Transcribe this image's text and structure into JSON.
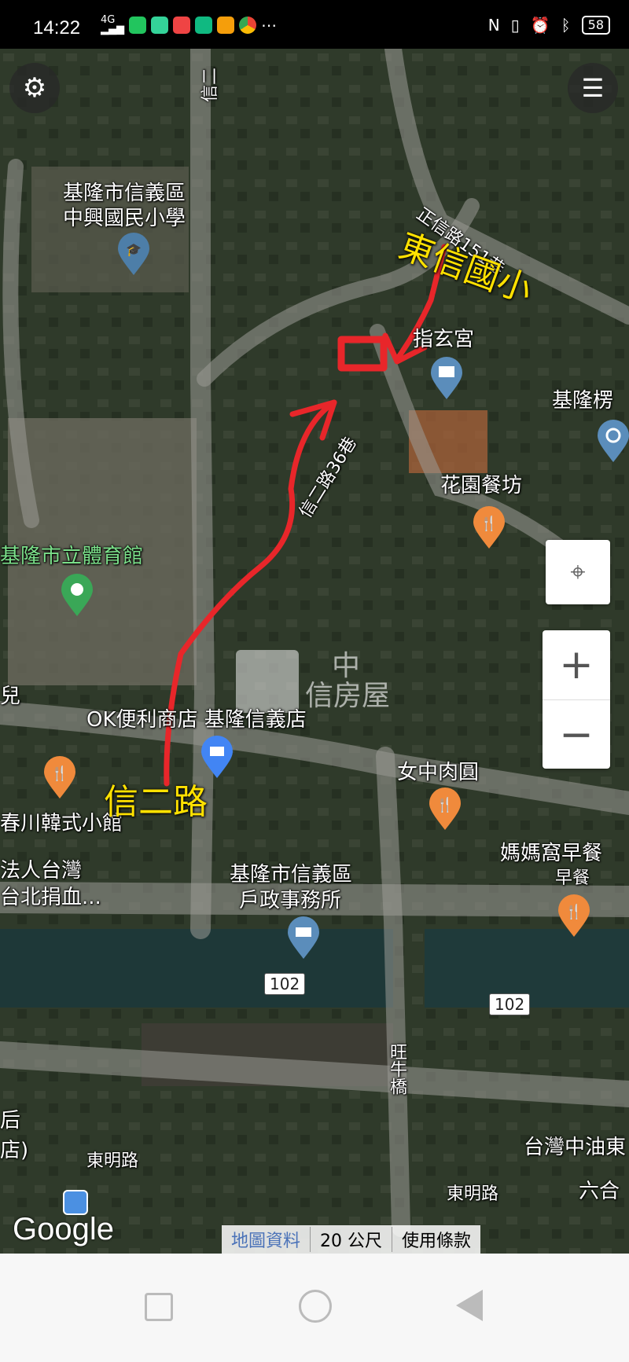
{
  "status_bar": {
    "time": "14:22",
    "network": "4G",
    "battery": "58"
  },
  "map": {
    "labels": {
      "school_1": "基隆市信義區",
      "school_2": "中興國民小學",
      "zhixuan": "指玄宮",
      "stadium": "基隆市立體育館",
      "restaurant_garden": "花園餐坊",
      "ok_store": "OK便利商店 基隆信義店",
      "meatball": "女中肉圓",
      "korean": "春川韓式小館",
      "blood_1": "法人台灣",
      "blood_2": "台北捐血...",
      "household_1": "基隆市信義區",
      "household_2": "戶政事務所",
      "breakfast": "媽媽窩早餐",
      "breakfast_sub": "早餐",
      "keelung_cut": "基隆楞",
      "kids_cut": "兒",
      "store_cut": "店)",
      "store_cut2": "后",
      "cpc": "台灣中油東",
      "liuhe": "六合"
    },
    "streets": {
      "zhengxin": "正信路151巷",
      "xiner_lane": "信二路36巷",
      "dongming_1": "東明路",
      "dongming_2": "東明路",
      "wangniu": "旺牛橋",
      "xiner_top": "信二"
    },
    "route_badges": [
      "102",
      "102"
    ],
    "annotations": {
      "school": "東信國小",
      "road": "信二路"
    },
    "watermark": {
      "top": "中",
      "bottom": "信房屋"
    },
    "footer": {
      "map_data": "地圖資料",
      "scale": "20 公尺",
      "terms": "使用條款"
    },
    "brand": "Google"
  },
  "colors": {
    "accent_red": "#e8262a",
    "annotation_yellow": "#ffe100"
  }
}
